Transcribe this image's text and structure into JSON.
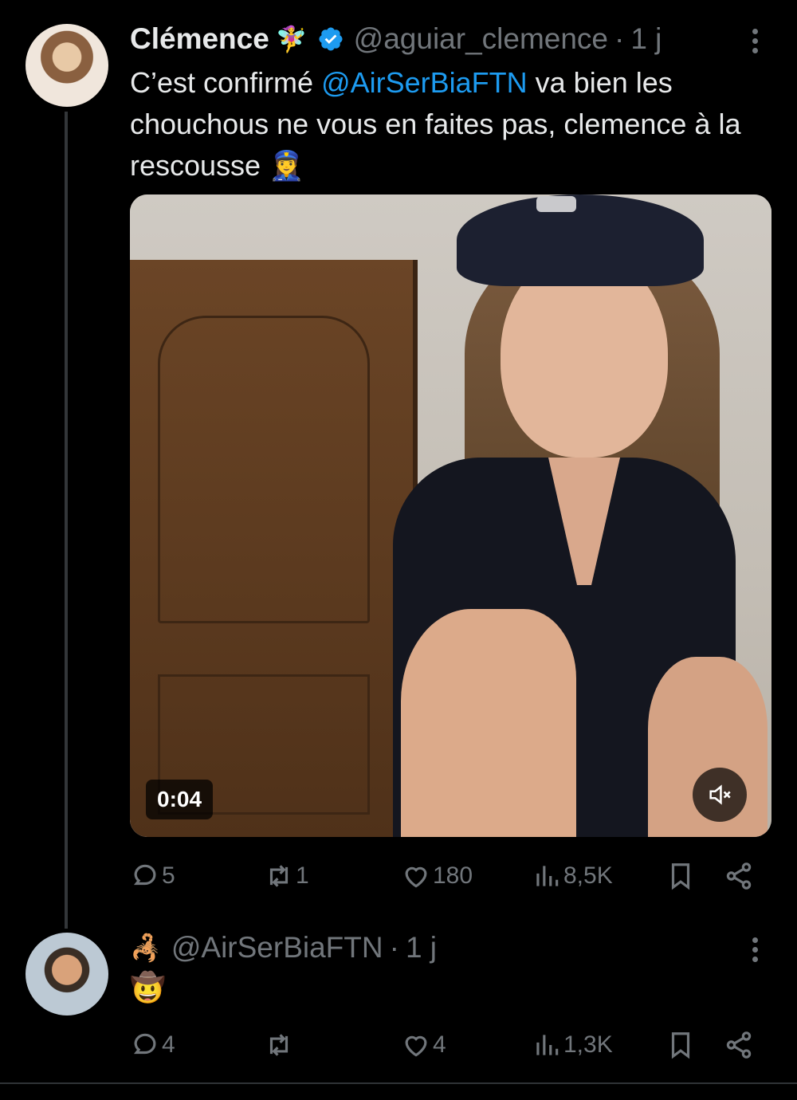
{
  "tweet": {
    "author_name": "Clémence",
    "name_emoji": "🧚‍♀️",
    "handle": "@aguiar_clemence",
    "separator": "·",
    "time": "1 j",
    "text_part1": "C’est confirmé ",
    "mention": "@AirSerBiaFTN",
    "text_part2": " va bien les chouchous ne vous en faites pas, clemence à la rescousse ",
    "text_emoji": "👮‍♀️",
    "video": {
      "duration": "0:04"
    },
    "stats": {
      "replies": "5",
      "retweets": "1",
      "likes": "180",
      "views": "8,5K"
    }
  },
  "reply": {
    "name_emoji": "🦂",
    "handle": "@AirSerBiaFTN",
    "separator": "·",
    "time": "1 j",
    "text": "🤠",
    "stats": {
      "replies": "4",
      "retweets": "",
      "likes": "4",
      "views": "1,3K"
    }
  },
  "colors": {
    "background": "#000000",
    "accent": "#1d9bf0",
    "muted": "#71767b",
    "text": "#e7e9ea"
  }
}
